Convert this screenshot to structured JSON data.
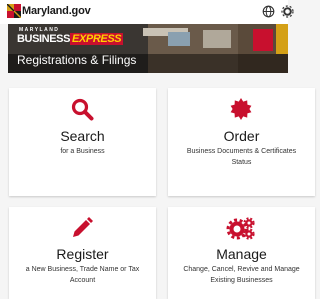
{
  "header": {
    "site_name": "Maryland.gov",
    "icons": [
      "maryland-flag-logo",
      "globe-icon",
      "gear-icon"
    ]
  },
  "banner": {
    "brand_top": "MARYLAND",
    "brand_word1": "BUSINESS",
    "brand_word2": "EXPRESS",
    "title": "Registrations & Filings"
  },
  "cards": {
    "search": {
      "title": "Search",
      "subtitle": "for a Business",
      "icon": "search-icon"
    },
    "order": {
      "title": "Order",
      "subtitle_line1": "Business Documents & Certificates",
      "subtitle_line2": "Status",
      "icon": "badge-icon"
    },
    "register": {
      "title": "Register",
      "subtitle_line1": "a New Business, Trade Name or Tax",
      "subtitle_line2": "Account",
      "icon": "pencil-icon"
    },
    "manage": {
      "title": "Manage",
      "subtitle_line1": "Change, Cancel, Revive and Manage",
      "subtitle_line2": "Existing Businesses",
      "icon": "gears-icon"
    }
  },
  "colors": {
    "accent": "#c8102e",
    "brand_yellow": "#ffd200",
    "page_bg": "#f5f5f5"
  }
}
